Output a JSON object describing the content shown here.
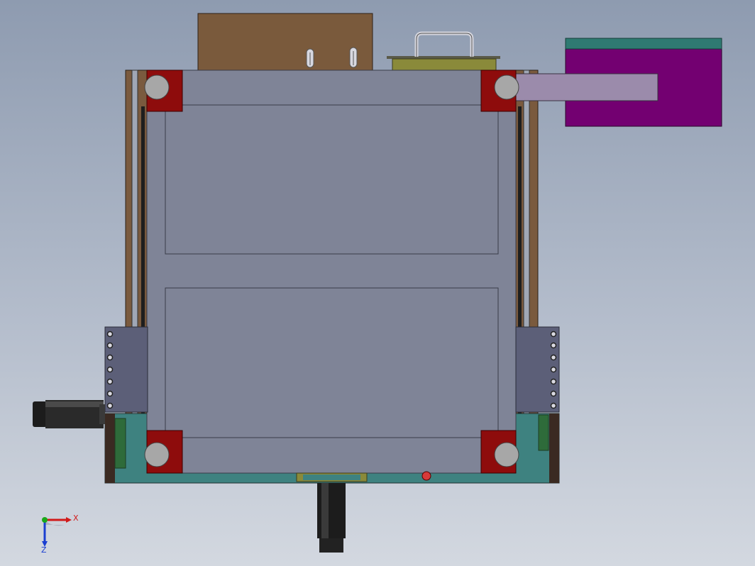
{
  "viewport": {
    "background_top": "#8e9bb0",
    "background_bottom": "#d3d8e0"
  },
  "colors": {
    "frame_panel": "#7f8497",
    "panel_outline": "#3a3c48",
    "corner_block": "#8e0c0c",
    "roller": "#a7a7a7",
    "rail_brown": "#7a5a3e",
    "top_plate_brown": "#7a5a3c",
    "handle_plate": "#8a8a3a",
    "motor_purple": "#730071",
    "motor_top": "#2f7a72",
    "pusher_lilac": "#9b8bab",
    "side_bracket": "#5c5f78",
    "base_teal": "#3e8280",
    "cylinder_black": "#1c1c1c"
  },
  "model": {
    "parts": [
      "top-plate",
      "handle",
      "main-frame",
      "upper-window",
      "lower-window",
      "left-rail",
      "right-rail",
      "corner-roller-top-left",
      "corner-roller-top-right",
      "corner-roller-bottom-left",
      "corner-roller-bottom-right",
      "motor-block",
      "pusher-arm",
      "left-side-bracket",
      "right-side-bracket",
      "left-cylinder",
      "bottom-cylinder",
      "base-plate"
    ]
  },
  "triad": {
    "x_label": "X",
    "z_label": "Z",
    "x_color": "#d11a1a",
    "y_color": "#1aa81a",
    "z_color": "#1a3ed1"
  }
}
